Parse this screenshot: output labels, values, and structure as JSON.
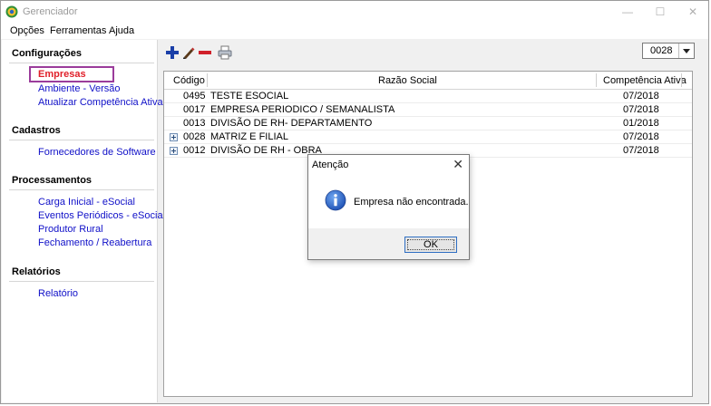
{
  "window": {
    "title": "Gerenciador",
    "controls": {
      "minimize": "—",
      "maximize": "☐",
      "close": "✕"
    }
  },
  "menu": [
    "Opções",
    "Ferramentas",
    "Ajuda"
  ],
  "sidebar": {
    "sections": [
      {
        "header": "Configurações",
        "items": [
          "Empresas",
          "Ambiente - Versão",
          "Atualizar Competência Ativa"
        ]
      },
      {
        "header": "Cadastros",
        "items": [
          "Fornecedores de Software"
        ]
      },
      {
        "header": "Processamentos",
        "items": [
          "Carga Inicial - eSocial",
          "Eventos Periódicos - eSocial",
          "Produtor Rural",
          "Fechamento / Reabertura"
        ]
      },
      {
        "header": "Relatórios",
        "items": [
          "Relatório"
        ]
      }
    ]
  },
  "toolbar": {
    "icons": [
      "add-icon",
      "edit-icon",
      "remove-icon",
      "print-icon"
    ],
    "company_select": "0028"
  },
  "grid": {
    "columns": [
      "Código",
      "Razão Social",
      "Competência Ativa"
    ],
    "rows": [
      {
        "code": "0495",
        "name": "TESTE ESOCIAL",
        "competencia": "07/2018",
        "expandable": false
      },
      {
        "code": "0017",
        "name": "EMPRESA PERIODICO / SEMANALISTA",
        "competencia": "07/2018",
        "expandable": false
      },
      {
        "code": "0013",
        "name": "DIVISÃO DE RH- DEPARTAMENTO",
        "competencia": "01/2018",
        "expandable": false
      },
      {
        "code": "0028",
        "name": "MATRIZ E FILIAL",
        "competencia": "07/2018",
        "expandable": true
      },
      {
        "code": "0012",
        "name": "DIVISÃO DE RH - OBRA",
        "competencia": "07/2018",
        "expandable": true
      }
    ]
  },
  "dialog": {
    "title": "Atenção",
    "message": "Empresa não encontrada.",
    "ok_label": "OK",
    "icon": "info-icon"
  },
  "colors": {
    "link": "#1010c8",
    "active_link": "#e0202a",
    "highlight_box": "#9b3c9b"
  }
}
